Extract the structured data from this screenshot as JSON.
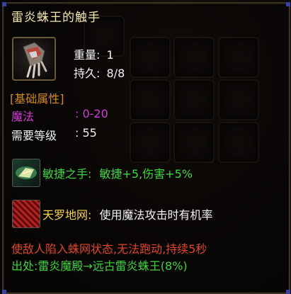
{
  "item": {
    "name": "雷炎蛛王的触手",
    "weight_label": "重量:",
    "weight_value": "1",
    "durability_label": "持久:",
    "durability_value": "8/8"
  },
  "base_attributes": {
    "header": "[基础属性]",
    "magic_label": "魔法",
    "magic_value": ": 0-20",
    "level_label": "需要等级",
    "level_value": ": 55"
  },
  "skills": [
    {
      "name": "敏捷之手:",
      "effect": "敏捷+5,伤害+5%",
      "icon": "glowing-hand-icon"
    },
    {
      "name": "天罗地网:",
      "effect": "使用魔法攻击时有机率",
      "icon": "spider-web-icon"
    }
  ],
  "description": "使敌人陷入蛛网状态,无法跑动,持续5秒",
  "source": "出处:雷炎魔殿→远古雷炎蛛王(8%)",
  "colors": {
    "title": "#f3e6b0",
    "header": "#d68a1c",
    "magic": "#d23bd6",
    "skill_green": "#3ed63e",
    "skill_gold": "#f6d24a",
    "description": "#e2452c",
    "source": "#3ed63e"
  }
}
